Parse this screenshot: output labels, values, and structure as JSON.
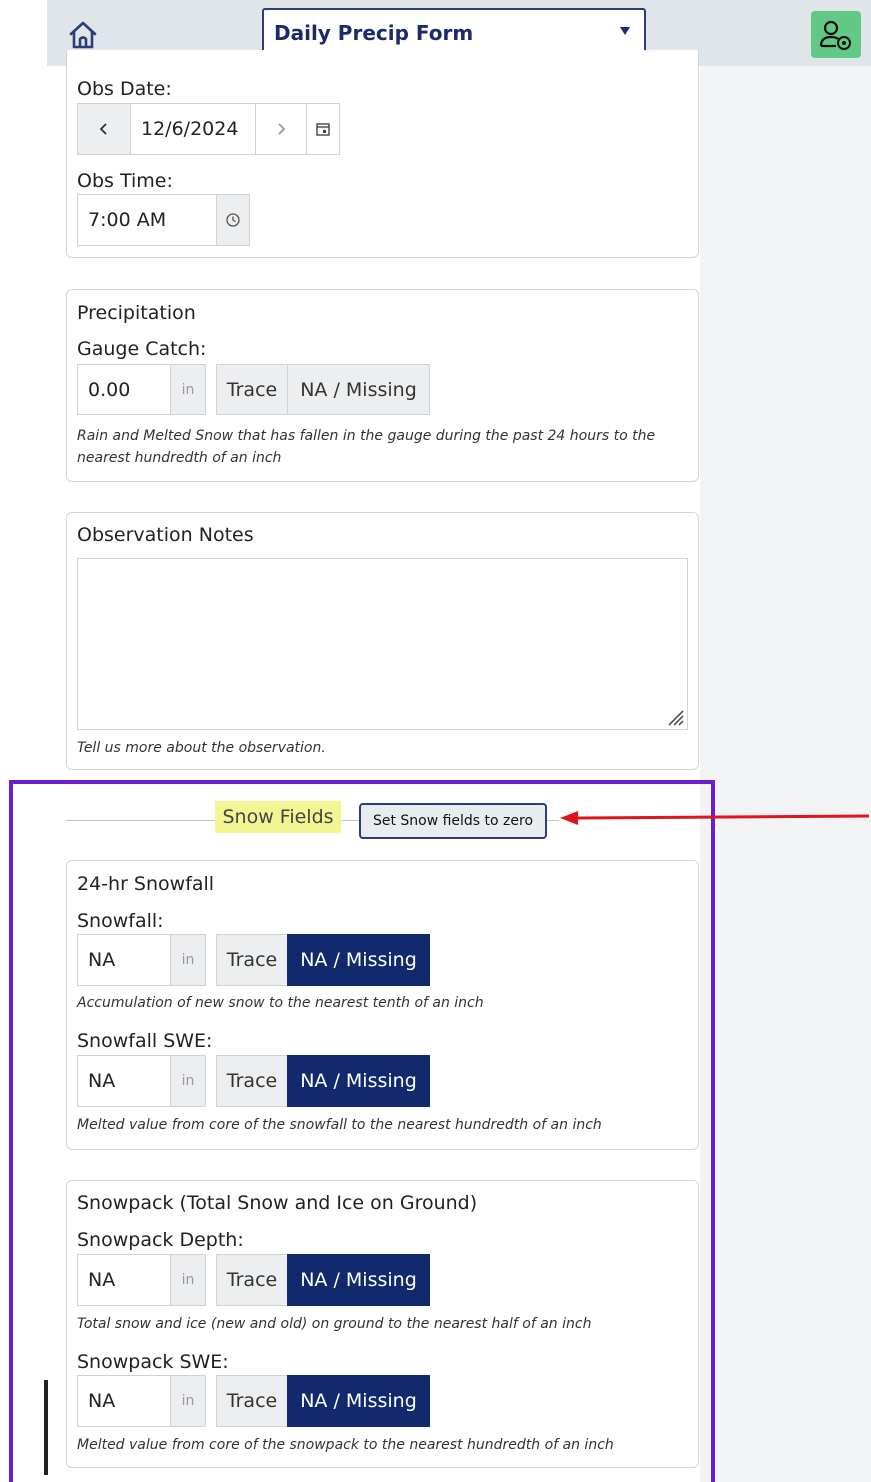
{
  "header": {
    "form_selector": "Daily Precip Form",
    "colors": {
      "bar": "#dfe5e8",
      "user_button": "#61c885",
      "accent": "#2d3d7a"
    }
  },
  "obs": {
    "date_label": "Obs Date:",
    "date_value": "12/6/2024",
    "time_label": "Obs Time:",
    "time_value": "7:00 AM"
  },
  "precip": {
    "title": "Precipitation",
    "gauge_label": "Gauge Catch:",
    "gauge_value": "0.00",
    "unit": "in",
    "trace_label": "Trace",
    "na_label": "NA / Missing",
    "help": "Rain and Melted Snow that has fallen in the gauge during the past 24 hours to the nearest hundredth of an inch"
  },
  "notes": {
    "title": "Observation Notes",
    "value": "",
    "help": "Tell us more about the observation."
  },
  "snow": {
    "section_label": "Snow Fields",
    "zero_button": "Set Snow fields to zero",
    "snowfall_card": {
      "title": "24-hr Snowfall",
      "snowfall_label": "Snowfall:",
      "snowfall_value": "NA",
      "snowfall_help": "Accumulation of new snow to the nearest tenth of an inch",
      "swe_label": "Snowfall SWE:",
      "swe_value": "NA",
      "swe_help": "Melted value from core of the snowfall to the nearest hundredth of an inch"
    },
    "snowpack_card": {
      "title": "Snowpack (Total Snow and Ice on Ground)",
      "depth_label": "Snowpack Depth:",
      "depth_value": "NA",
      "depth_help": "Total snow and ice (new and old) on ground to the nearest half of an inch",
      "swe_label": "Snowpack SWE:",
      "swe_value": "NA",
      "swe_help": "Melted value from core of the snowpack to the nearest hundredth of an inch"
    },
    "unit": "in",
    "trace_label": "Trace",
    "na_label": "NA / Missing",
    "colors": {
      "na_active": "#12296e",
      "highlight": "#f3f592",
      "frame": "#6a1fd0",
      "arrow": "#e0141e"
    }
  }
}
